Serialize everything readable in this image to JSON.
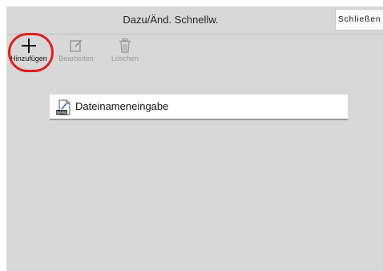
{
  "window": {
    "title": "Dazu/Änd. Schnellw.",
    "close_label": "Schließen"
  },
  "toolbar": {
    "add_label": "Hinzufügen",
    "edit_label": "Bearbeiten",
    "delete_label": "Löschen",
    "add_icon": "plus-icon",
    "edit_icon": "edit-icon",
    "delete_icon": "trash-icon"
  },
  "list": {
    "items": [
      {
        "label": "Dateinameneingabe",
        "icon": "file-name-icon",
        "icon_badge": "NAME"
      }
    ]
  },
  "colors": {
    "highlight": "#e02020",
    "background": "#d8d8d8",
    "disabled_text": "#9a9a9a"
  }
}
